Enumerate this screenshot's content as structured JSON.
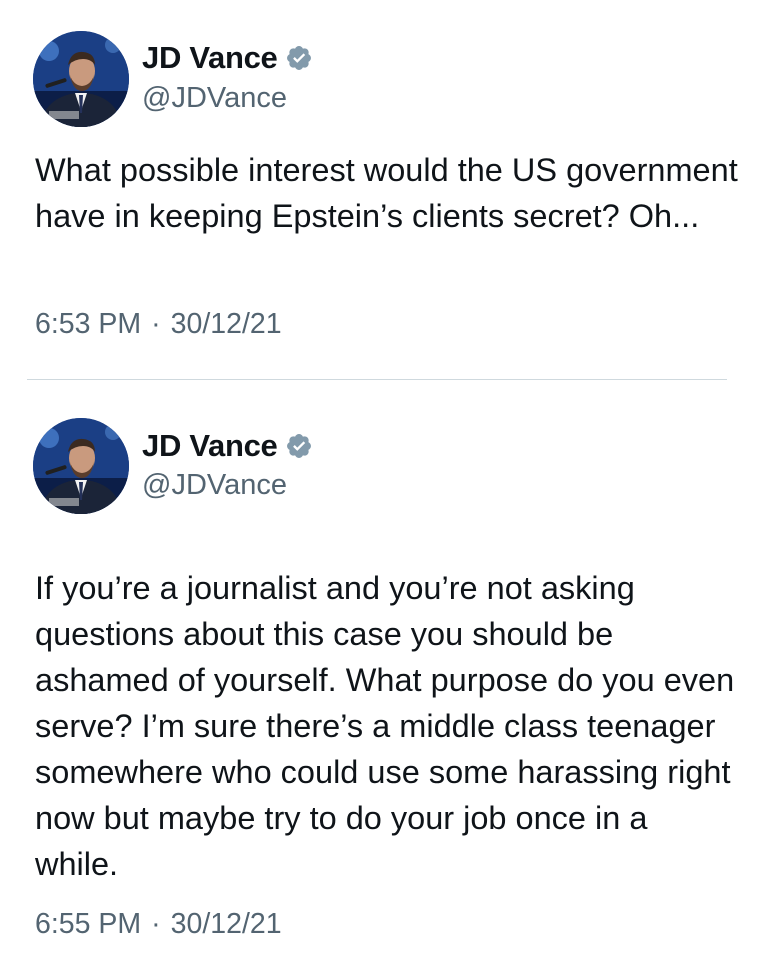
{
  "tweets": [
    {
      "author": {
        "name": "JD Vance",
        "handle": "@JDVance",
        "verified_badge_icon": "verified-badge-icon"
      },
      "text": "What possible interest would the US government have in keeping Epstein’s clients secret? Oh...",
      "time": "6:53 PM",
      "separator": "·",
      "date": "30/12/21"
    },
    {
      "author": {
        "name": "JD Vance",
        "handle": "@JDVance",
        "verified_badge_icon": "verified-badge-icon"
      },
      "text": "If you’re a journalist and you’re not asking questions about this case you should be ashamed of yourself. What purpose do you even serve? I’m sure there’s a middle class teenager somewhere who could use some harassing right now but maybe try to do your job once in a while.",
      "time": "6:55 PM",
      "separator": "·",
      "date": "30/12/21"
    }
  ],
  "colors": {
    "primary_text": "#0f1419",
    "secondary_text": "#536471",
    "badge": "#829aab",
    "divider": "#cfd9de"
  }
}
